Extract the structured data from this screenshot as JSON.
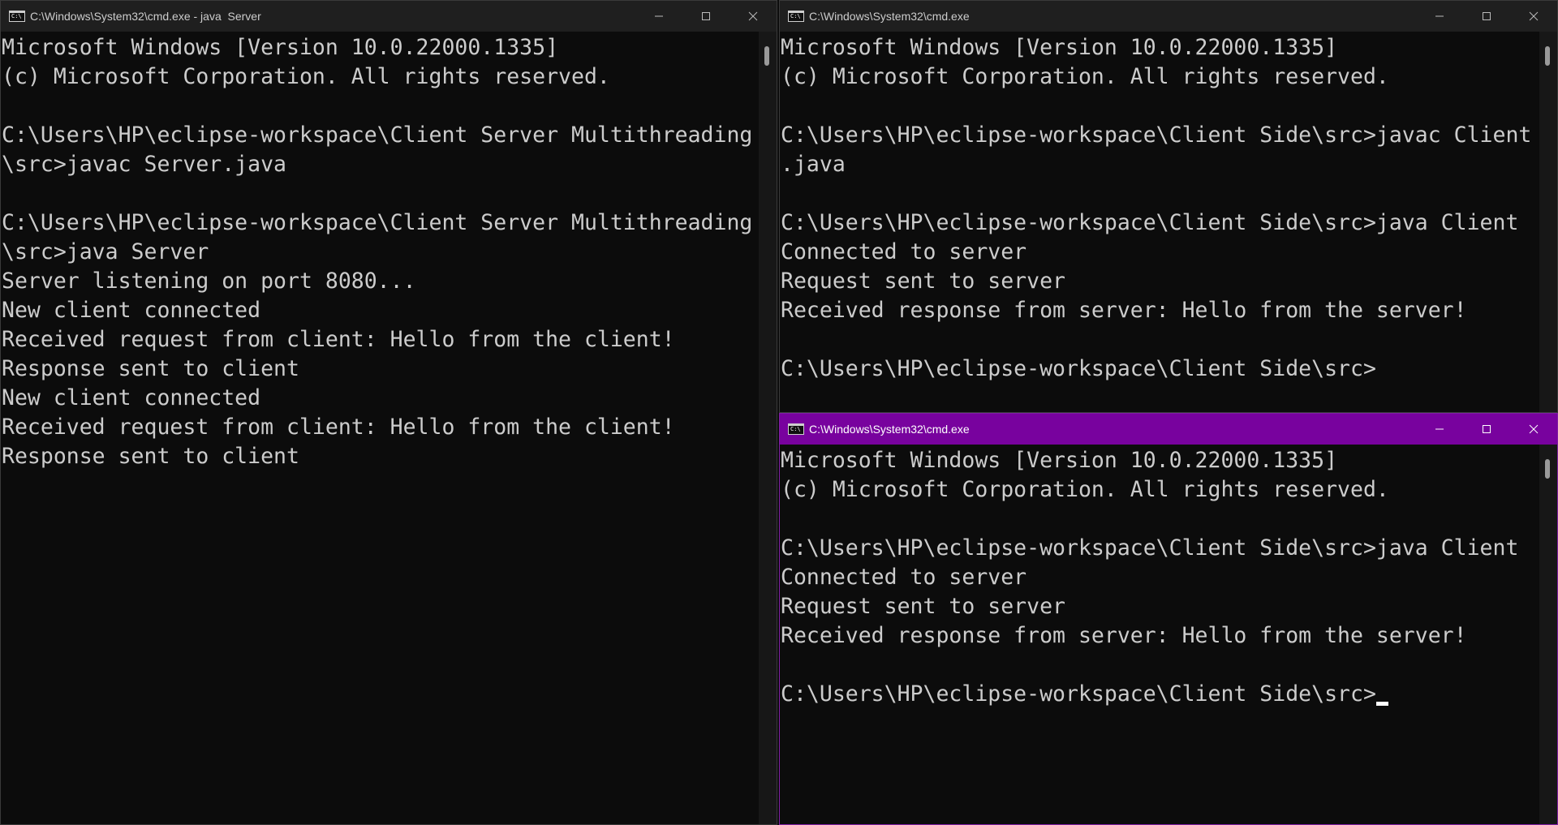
{
  "windows": {
    "server": {
      "title": "C:\\Windows\\System32\\cmd.exe - java  Server",
      "lines": [
        "Microsoft Windows [Version 10.0.22000.1335]",
        "(c) Microsoft Corporation. All rights reserved.",
        "",
        "C:\\Users\\HP\\eclipse-workspace\\Client Server Multithreading",
        "\\src>javac Server.java",
        "",
        "C:\\Users\\HP\\eclipse-workspace\\Client Server Multithreading",
        "\\src>java Server",
        "Server listening on port 8080...",
        "New client connected",
        "Received request from client: Hello from the client!",
        "Response sent to client",
        "New client connected",
        "Received request from client: Hello from the client!",
        "Response sent to client"
      ]
    },
    "client1": {
      "title": "C:\\Windows\\System32\\cmd.exe",
      "lines": [
        "Microsoft Windows [Version 10.0.22000.1335]",
        "(c) Microsoft Corporation. All rights reserved.",
        "",
        "C:\\Users\\HP\\eclipse-workspace\\Client Side\\src>javac Client",
        ".java",
        "",
        "C:\\Users\\HP\\eclipse-workspace\\Client Side\\src>java Client",
        "Connected to server",
        "Request sent to server",
        "Received response from server: Hello from the server!",
        "",
        "C:\\Users\\HP\\eclipse-workspace\\Client Side\\src>"
      ]
    },
    "client2": {
      "title": "C:\\Windows\\System32\\cmd.exe",
      "active": true,
      "lines": [
        "Microsoft Windows [Version 10.0.22000.1335]",
        "(c) Microsoft Corporation. All rights reserved.",
        "",
        "C:\\Users\\HP\\eclipse-workspace\\Client Side\\src>java Client",
        "Connected to server",
        "Request sent to server",
        "Received response from server: Hello from the server!",
        "",
        "C:\\Users\\HP\\eclipse-workspace\\Client Side\\src>"
      ]
    }
  },
  "icons": {
    "app": "cmd-icon",
    "app_glyph": "C:\\",
    "minimize": "minimize-icon",
    "maximize": "maximize-icon",
    "close": "close-icon"
  },
  "colors": {
    "console_background": "#0c0c0c",
    "console_text": "#cccccc",
    "titlebar_inactive": "#1f1f1f",
    "titlebar_active": "#78029e"
  }
}
